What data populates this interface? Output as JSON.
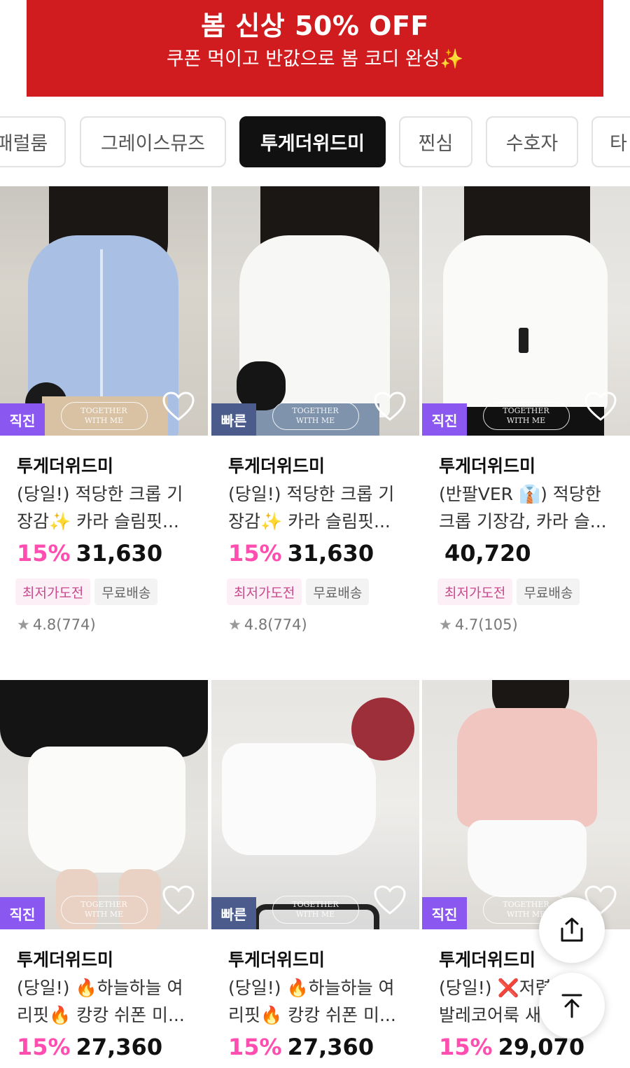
{
  "banner": {
    "title": "봄 신상 50% OFF",
    "subtitle": "쿠폰 먹이고 반값으로 봄 코디 완성✨",
    "color": "#d01c1f"
  },
  "tabs": [
    {
      "label": "패럴룸",
      "active": false
    },
    {
      "label": "그레이스뮤즈",
      "active": false
    },
    {
      "label": "투게더위드미",
      "active": true
    },
    {
      "label": "찐심",
      "active": false
    },
    {
      "label": "수호자",
      "active": false
    },
    {
      "label": "타",
      "active": false
    }
  ],
  "watermark": {
    "line1": "TOGETHER",
    "line2": "WITH ME"
  },
  "products": [
    {
      "badge": "직진",
      "badge_color": "#8a58f0",
      "store": "투게더위드미",
      "name_line1": "(당일!) 적당한 크롭 기",
      "name_line2": "장감✨ 카라 슬림핏...",
      "discount": "15%",
      "price": "31,630",
      "tag1": "최저가도전",
      "tag2": "무료배송",
      "rating": "4.8(774)"
    },
    {
      "badge": "빠른",
      "badge_color": "#4a5b8c",
      "store": "투게더위드미",
      "name_line1": "(당일!) 적당한 크롭 기",
      "name_line2": "장감✨ 카라 슬림핏...",
      "discount": "15%",
      "price": "31,630",
      "tag1": "최저가도전",
      "tag2": "무료배송",
      "rating": "4.8(774)"
    },
    {
      "badge": "직진",
      "badge_color": "#8a58f0",
      "store": "투게더위드미",
      "name_line1": "(반팔VER 👔) 적당한",
      "name_line2": "크롭 기장감, 카라 슬...",
      "discount": "",
      "price": "40,720",
      "tag1": "최저가도전",
      "tag2": "무료배송",
      "rating": "4.7(105)"
    },
    {
      "badge": "직진",
      "badge_color": "#8a58f0",
      "store": "투게더위드미",
      "name_line1": "(당일!) 🔥하늘하늘 여",
      "name_line2": "리핏🔥 캉캉 쉬폰 미...",
      "discount": "15%",
      "price": "27,360"
    },
    {
      "badge": "빠른",
      "badge_color": "#4a5b8c",
      "store": "투게더위드미",
      "name_line1": "(당일!) 🔥하늘하늘 여",
      "name_line2": "리핏🔥 캉캉 쉬폰 미...",
      "discount": "15%",
      "price": "27,360"
    },
    {
      "badge": "직진",
      "badge_color": "#8a58f0",
      "store": "투게더위드미",
      "name_line1": "(당일!) ❌저렴",
      "name_line2": "발레코어룩 새",
      "discount": "15%",
      "price": "29,070"
    }
  ],
  "icons": {
    "heart": "heart-icon",
    "share": "share-icon",
    "scroll_top": "arrow-up-to-top-icon",
    "star": "star-icon"
  },
  "colors": {
    "discount": "#ff4eb0",
    "active_tab": "#111111",
    "badge_purple": "#8a58f0",
    "badge_slate": "#4a5b8c"
  }
}
